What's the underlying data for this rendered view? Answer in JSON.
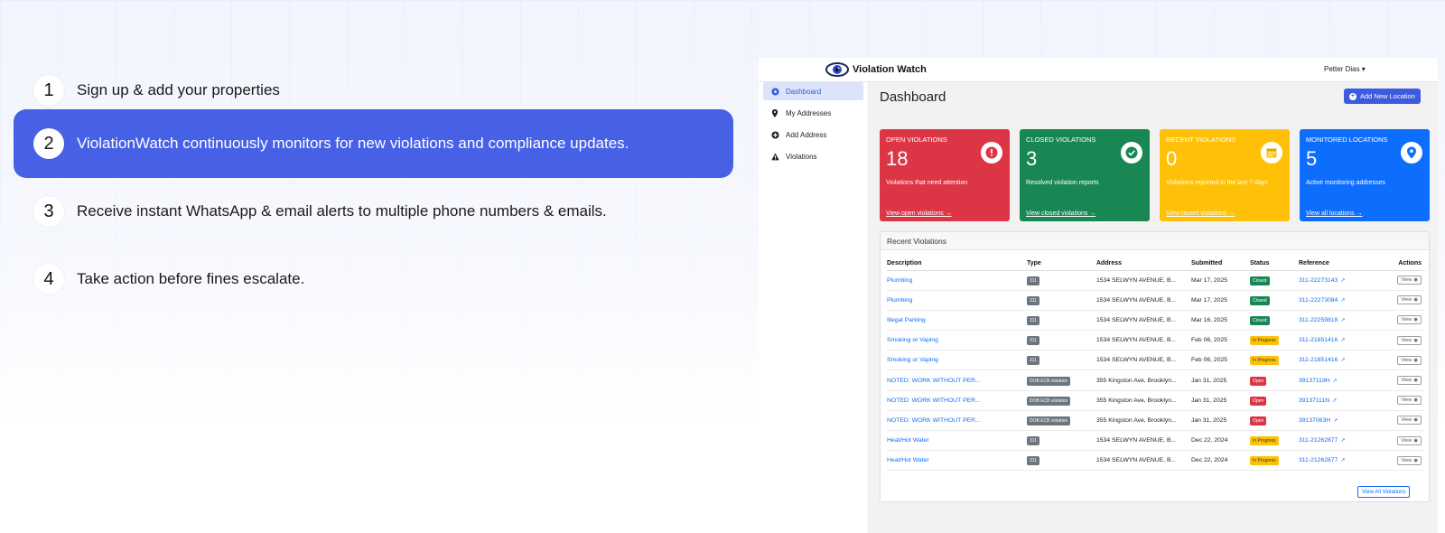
{
  "steps": [
    {
      "num": "1",
      "text": "Sign up & add your properties"
    },
    {
      "num": "2",
      "text": "ViolationWatch continuously monitors for new violations and compliance updates."
    },
    {
      "num": "3",
      "text": "Receive instant WhatsApp & email alerts to multiple phone numbers & emails."
    },
    {
      "num": "4",
      "text": "Take action before fines escalate."
    }
  ],
  "app": {
    "brand": "Violation Watch",
    "user": "Petter Dias ▾",
    "sidebar": [
      {
        "label": "Dashboard",
        "icon": "dashboard-icon"
      },
      {
        "label": "My Addresses",
        "icon": "map-pin-icon"
      },
      {
        "label": "Add Address",
        "icon": "plus-circle-icon"
      },
      {
        "label": "Violations",
        "icon": "warning-icon"
      }
    ],
    "page_title": "Dashboard",
    "add_location": "Add New Location",
    "cards": [
      {
        "label": "OPEN VIOLATIONS",
        "value": "18",
        "sub": "Violations that need attention",
        "link": "View open violations →",
        "color": "#dc3545",
        "icon": "alert-icon"
      },
      {
        "label": "CLOSED VIOLATIONS",
        "value": "3",
        "sub": "Resolved violation reports",
        "link": "View closed violations →",
        "color": "#198754",
        "icon": "check-icon"
      },
      {
        "label": "RECENT VIOLATIONS",
        "value": "0",
        "sub": "Violations reported in the last 7 days",
        "link": "View recent violations →",
        "color": "#ffc107",
        "icon": "calendar-icon"
      },
      {
        "label": "MONITORED LOCATIONS",
        "value": "5",
        "sub": "Active monitoring addresses",
        "link": "View all locations →",
        "color": "#0d6efd",
        "icon": "location-icon"
      }
    ],
    "recent": {
      "title": "Recent Violations",
      "columns": [
        "Description",
        "Type",
        "Address",
        "Submitted",
        "Status",
        "Reference",
        "Actions"
      ],
      "rows": [
        {
          "desc": "Plumbing",
          "type": "311",
          "addr": "1534 SELWYN AVENUE, B...",
          "date": "Mar 17, 2025",
          "status": "Closed",
          "ref": "311-22273143"
        },
        {
          "desc": "Plumbing",
          "type": "311",
          "addr": "1534 SELWYN AVENUE, B...",
          "date": "Mar 17, 2025",
          "status": "Closed",
          "ref": "311-22273084"
        },
        {
          "desc": "Illegal Parking",
          "type": "311",
          "addr": "1534 SELWYN AVENUE, B...",
          "date": "Mar 16, 2025",
          "status": "Closed",
          "ref": "311-22259818"
        },
        {
          "desc": "Smoking or Vaping",
          "type": "311",
          "addr": "1534 SELWYN AVENUE, B...",
          "date": "Feb 06, 2025",
          "status": "In Progress",
          "ref": "311-21851416"
        },
        {
          "desc": "Smoking or Vaping",
          "type": "311",
          "addr": "1534 SELWYN AVENUE, B...",
          "date": "Feb 06, 2025",
          "status": "In Progress",
          "ref": "311-21851416"
        },
        {
          "desc": "NOTED: WORK WITHOUT PER...",
          "type": "DOB ECB violation",
          "addr": "355 Kingston Ave, Brooklyn...",
          "date": "Jan 31, 2025",
          "status": "Open",
          "ref": "39137119H"
        },
        {
          "desc": "NOTED: WORK WITHOUT PER...",
          "type": "DOB ECB violation",
          "addr": "355 Kingston Ave, Brooklyn...",
          "date": "Jan 31, 2025",
          "status": "Open",
          "ref": "39137111N"
        },
        {
          "desc": "NOTED: WORK WITHOUT PER...",
          "type": "DOB ECB violation",
          "addr": "355 Kingston Ave, Brooklyn...",
          "date": "Jan 31, 2025",
          "status": "Open",
          "ref": "39137063H"
        },
        {
          "desc": "Heat/Hot Water",
          "type": "311",
          "addr": "1534 SELWYN AVENUE, B...",
          "date": "Dec 22, 2024",
          "status": "In Progress",
          "ref": "311-21262877"
        },
        {
          "desc": "Heat/Hot Water",
          "type": "311",
          "addr": "1534 SELWYN AVENUE, B...",
          "date": "Dec 22, 2024",
          "status": "In Progress",
          "ref": "311-21262877"
        }
      ],
      "view_label": "View",
      "view_all": "View All Violations"
    }
  }
}
